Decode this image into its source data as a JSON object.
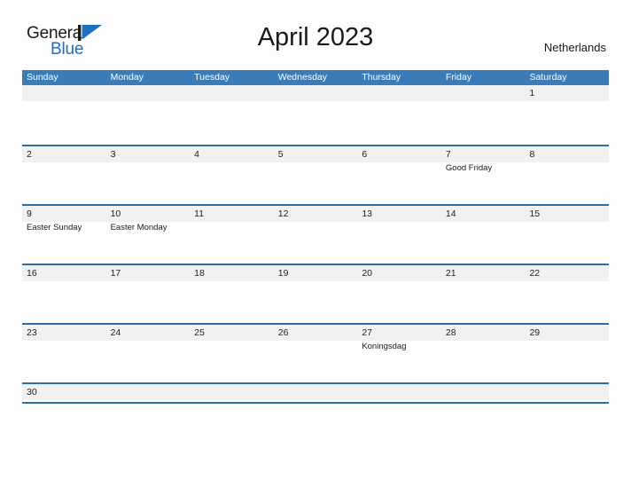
{
  "brand": {
    "name_part1": "General",
    "name_part2": "Blue",
    "mark_icon": "triangle-flag-icon",
    "accent_color": "#1f6fc0"
  },
  "header": {
    "title": "April 2023",
    "region": "Netherlands"
  },
  "colors": {
    "header_blue": "#3b7cb8",
    "row_rule_blue": "#2f6ea5",
    "band_grey": "#f1f1f1",
    "page_background": "#fdfdfd",
    "text": "#1a1a1a"
  },
  "calendar": {
    "weekdays": [
      "Sunday",
      "Monday",
      "Tuesday",
      "Wednesday",
      "Thursday",
      "Friday",
      "Saturday"
    ],
    "weeks": [
      [
        {
          "day": "",
          "event": ""
        },
        {
          "day": "",
          "event": ""
        },
        {
          "day": "",
          "event": ""
        },
        {
          "day": "",
          "event": ""
        },
        {
          "day": "",
          "event": ""
        },
        {
          "day": "",
          "event": ""
        },
        {
          "day": "1",
          "event": ""
        }
      ],
      [
        {
          "day": "2",
          "event": ""
        },
        {
          "day": "3",
          "event": ""
        },
        {
          "day": "4",
          "event": ""
        },
        {
          "day": "5",
          "event": ""
        },
        {
          "day": "6",
          "event": ""
        },
        {
          "day": "7",
          "event": "Good Friday"
        },
        {
          "day": "8",
          "event": ""
        }
      ],
      [
        {
          "day": "9",
          "event": "Easter Sunday"
        },
        {
          "day": "10",
          "event": "Easter Monday"
        },
        {
          "day": "11",
          "event": ""
        },
        {
          "day": "12",
          "event": ""
        },
        {
          "day": "13",
          "event": ""
        },
        {
          "day": "14",
          "event": ""
        },
        {
          "day": "15",
          "event": ""
        }
      ],
      [
        {
          "day": "16",
          "event": ""
        },
        {
          "day": "17",
          "event": ""
        },
        {
          "day": "18",
          "event": ""
        },
        {
          "day": "19",
          "event": ""
        },
        {
          "day": "20",
          "event": ""
        },
        {
          "day": "21",
          "event": ""
        },
        {
          "day": "22",
          "event": ""
        }
      ],
      [
        {
          "day": "23",
          "event": ""
        },
        {
          "day": "24",
          "event": ""
        },
        {
          "day": "25",
          "event": ""
        },
        {
          "day": "26",
          "event": ""
        },
        {
          "day": "27",
          "event": "Koningsdag"
        },
        {
          "day": "28",
          "event": ""
        },
        {
          "day": "29",
          "event": ""
        }
      ],
      [
        {
          "day": "30",
          "event": ""
        },
        {
          "day": "",
          "event": ""
        },
        {
          "day": "",
          "event": ""
        },
        {
          "day": "",
          "event": ""
        },
        {
          "day": "",
          "event": ""
        },
        {
          "day": "",
          "event": ""
        },
        {
          "day": "",
          "event": ""
        }
      ]
    ]
  }
}
